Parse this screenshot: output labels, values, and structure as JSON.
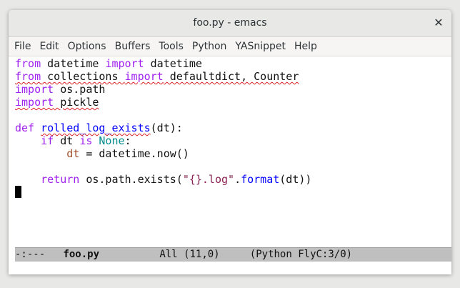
{
  "window": {
    "title": "foo.py - emacs"
  },
  "menubar": {
    "items": [
      "File",
      "Edit",
      "Options",
      "Buffers",
      "Tools",
      "Python",
      "YASnippet",
      "Help"
    ]
  },
  "editor": {
    "line1": {
      "kw1": "from",
      "mod": " datetime ",
      "kw2": "import",
      "name": " datetime"
    },
    "line2": {
      "kw1": "from",
      "mod": " collections ",
      "kw2": "import",
      "name": " defaultdict, Counter"
    },
    "line3": {
      "kw1": "import",
      "name": " os.path"
    },
    "line4": {
      "kw1": "import",
      "name": " pickle"
    },
    "line6": {
      "kw1": "def",
      "fn": "rolled_log_exists",
      "rest": "(dt):"
    },
    "line7": {
      "indent": "    ",
      "kw1": "if",
      "mid": " dt ",
      "kw2": "is",
      "const": "None",
      "rest": ":"
    },
    "line8": {
      "indent": "        ",
      "var": "dt",
      "rest": " = datetime.now()"
    },
    "line10": {
      "indent": "    ",
      "kw1": "return",
      "mid": " os.path.exists(",
      "str": "\"{}.log\"",
      "dot": ".",
      "method": "format",
      "rest": "(dt))"
    }
  },
  "modeline": {
    "state": "-:---",
    "buffer": "foo.py",
    "position": "All (11,0)",
    "modes": "(Python FlyC:3/0)"
  }
}
